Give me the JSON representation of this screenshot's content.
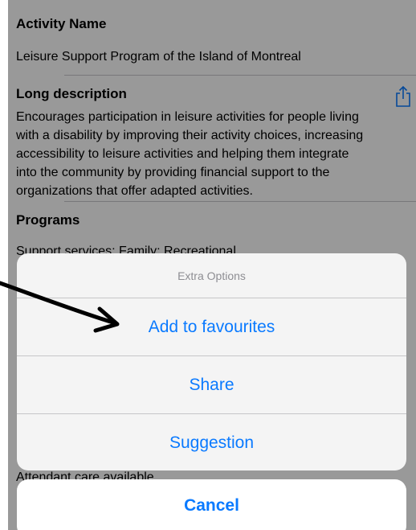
{
  "sections": {
    "activity_name_title": "Activity Name",
    "activity_name_value": "Leisure Support Program of the Island of Montreal",
    "long_description_title": "Long description",
    "long_description_lines": [
      "Encourages participation in leisure activities for people living",
      "with a disability by improving their activity choices, increasing",
      "accessibility to leisure activities and helping them integrate",
      "into the community by providing financial support to the",
      "organizations that offer adapted activities."
    ],
    "programs_title": "Programs",
    "programs_value": "Support services; Family; Recreational",
    "attendant_value": "Attendant care available"
  },
  "action_sheet": {
    "header": "Extra Options",
    "options": [
      "Add to favourites",
      "Share",
      "Suggestion"
    ],
    "cancel": "Cancel"
  },
  "icons": {
    "share": "share-icon",
    "annotation": "arrow-icon"
  },
  "colors": {
    "accent": "#0a7aff",
    "header_text": "#8e8e93"
  }
}
